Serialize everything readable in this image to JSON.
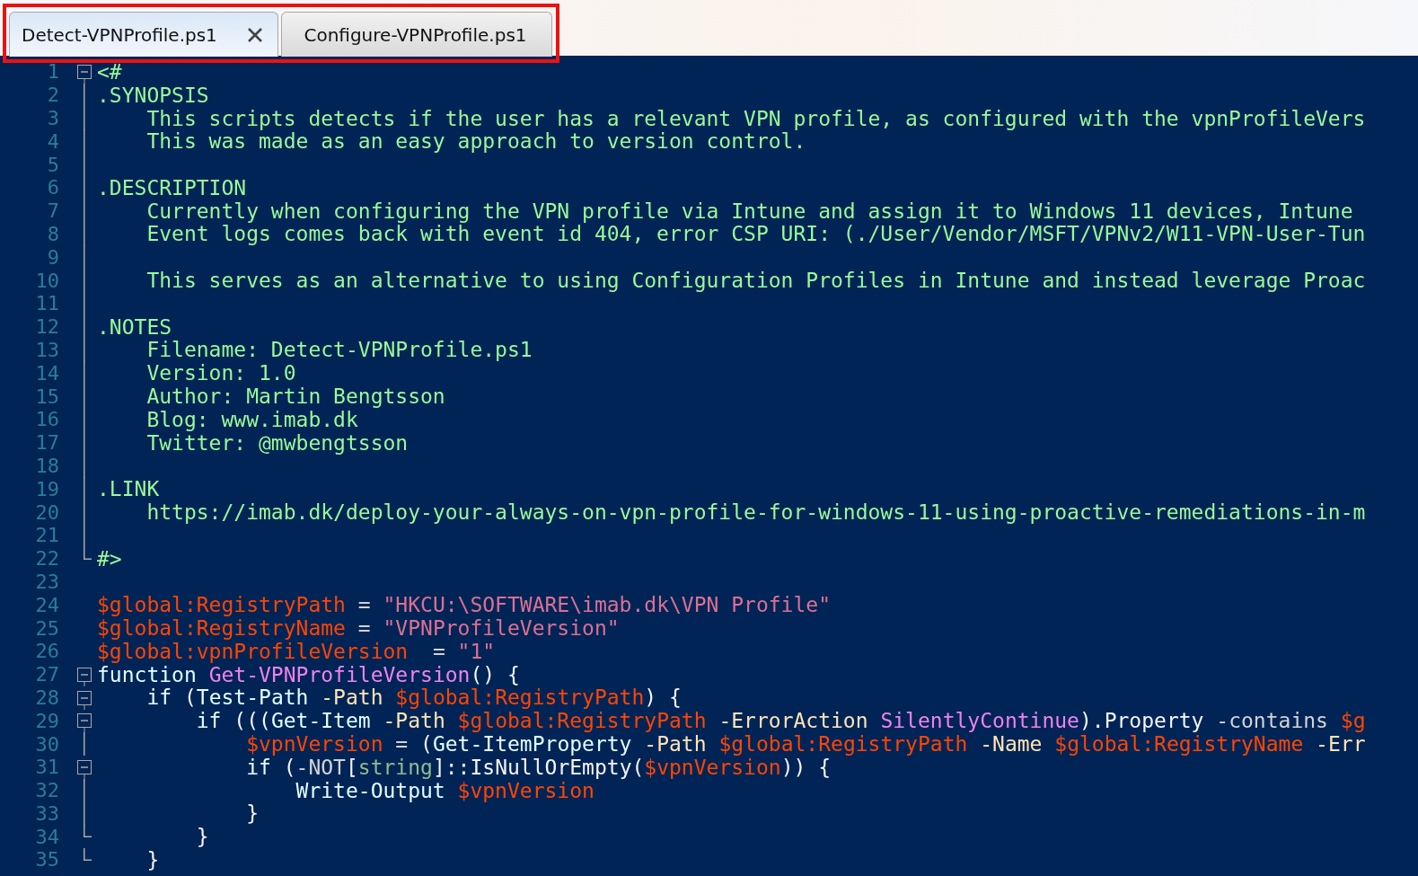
{
  "tabs": [
    {
      "label": "Detect-VPNProfile.ps1",
      "selected": true
    },
    {
      "label": "Configure-VPNProfile.ps1",
      "selected": false
    }
  ],
  "editor": {
    "lines": [
      {
        "number": "1",
        "kind": "open",
        "tokens": [
          {
            "text": "<#",
            "kind": "comment"
          }
        ]
      },
      {
        "number": "2",
        "kind": "line",
        "tokens": [
          {
            "text": ".SYNOPSIS",
            "kind": "comment"
          }
        ]
      },
      {
        "number": "3",
        "kind": "line",
        "tokens": [
          {
            "text": "    This scripts detects if the user has a relevant VPN profile, as configured with the vpnProfileVers",
            "kind": "comment"
          }
        ]
      },
      {
        "number": "4",
        "kind": "line",
        "tokens": [
          {
            "text": "    This was made as an easy approach to version control.",
            "kind": "comment"
          }
        ]
      },
      {
        "number": "5",
        "kind": "line"
      },
      {
        "number": "6",
        "kind": "line",
        "tokens": [
          {
            "text": ".DESCRIPTION",
            "kind": "comment"
          }
        ]
      },
      {
        "number": "7",
        "kind": "line",
        "tokens": [
          {
            "text": "    Currently when configuring the VPN profile via Intune and assign it to Windows 11 devices, Intune",
            "kind": "comment"
          }
        ]
      },
      {
        "number": "8",
        "kind": "line",
        "tokens": [
          {
            "text": "    Event logs comes back with event id 404, error CSP URI: (./User/Vendor/MSFT/VPNv2/W11-VPN-User-Tun",
            "kind": "comment"
          }
        ]
      },
      {
        "number": "9",
        "kind": "line"
      },
      {
        "number": "10",
        "kind": "line",
        "tokens": [
          {
            "text": "    This serves as an alternative to using Configuration Profiles in Intune and instead leverage Proac",
            "kind": "comment"
          }
        ]
      },
      {
        "number": "11",
        "kind": "line"
      },
      {
        "number": "12",
        "kind": "line",
        "tokens": [
          {
            "text": ".NOTES",
            "kind": "comment"
          }
        ]
      },
      {
        "number": "13",
        "kind": "line",
        "tokens": [
          {
            "text": "    Filename: Detect-VPNProfile.ps1",
            "kind": "comment"
          }
        ]
      },
      {
        "number": "14",
        "kind": "line",
        "tokens": [
          {
            "text": "    Version: 1.0",
            "kind": "comment"
          }
        ]
      },
      {
        "number": "15",
        "kind": "line",
        "tokens": [
          {
            "text": "    Author: Martin Bengtsson",
            "kind": "comment"
          }
        ]
      },
      {
        "number": "16",
        "kind": "line",
        "tokens": [
          {
            "text": "    Blog: www.imab.dk",
            "kind": "comment"
          }
        ]
      },
      {
        "number": "17",
        "kind": "line",
        "tokens": [
          {
            "text": "    Twitter: @mwbengtsson",
            "kind": "comment"
          }
        ]
      },
      {
        "number": "18",
        "kind": "line"
      },
      {
        "number": "19",
        "kind": "line",
        "tokens": [
          {
            "text": ".LINK",
            "kind": "comment"
          }
        ]
      },
      {
        "number": "20",
        "kind": "line",
        "tokens": [
          {
            "text": "    https://imab.dk/deploy-your-always-on-vpn-profile-for-windows-11-using-proactive-remediations-in-m",
            "kind": "comment"
          }
        ]
      },
      {
        "number": "21",
        "kind": "line"
      },
      {
        "number": "22",
        "kind": "end",
        "tokens": [
          {
            "text": "#>",
            "kind": "comment"
          }
        ]
      },
      {
        "number": "23"
      },
      {
        "number": "24",
        "tokens": [
          {
            "text": "$global:RegistryPath",
            "kind": "variable"
          },
          {
            "text": " = ",
            "kind": "operator"
          },
          {
            "text": "\"HKCU:\\SOFTWARE\\imab.dk\\VPN Profile\"",
            "kind": "string"
          }
        ]
      },
      {
        "number": "25",
        "tokens": [
          {
            "text": "$global:RegistryName",
            "kind": "variable"
          },
          {
            "text": " = ",
            "kind": "operator"
          },
          {
            "text": "\"VPNProfileVersion\"",
            "kind": "string"
          }
        ]
      },
      {
        "number": "26",
        "tokens": [
          {
            "text": "$global:vpnProfileVersion",
            "kind": "variable"
          },
          {
            "text": "  = ",
            "kind": "operator"
          },
          {
            "text": "\"1\"",
            "kind": "string"
          }
        ]
      },
      {
        "number": "27",
        "kind": "open",
        "tokens": [
          {
            "text": "function",
            "kind": "keyword"
          },
          {
            "text": " Get-VPNProfileVersion",
            "kind": "argument"
          },
          {
            "text": "() {",
            "kind": "plain"
          }
        ]
      },
      {
        "number": "28",
        "kind": "open",
        "tokens": [
          {
            "text": "    if",
            "kind": "keyword"
          },
          {
            "text": " (",
            "kind": "plain"
          },
          {
            "text": "Test-Path",
            "kind": "command"
          },
          {
            "text": " -Path",
            "kind": "parameter"
          },
          {
            "text": " $global:RegistryPath",
            "kind": "variable"
          },
          {
            "text": ") {",
            "kind": "plain"
          }
        ]
      },
      {
        "number": "29",
        "kind": "open",
        "tokens": [
          {
            "text": "        if",
            "kind": "keyword"
          },
          {
            "text": " (((",
            "kind": "plain"
          },
          {
            "text": "Get-Item",
            "kind": "command"
          },
          {
            "text": " -Path",
            "kind": "parameter"
          },
          {
            "text": " $global:RegistryPath",
            "kind": "variable"
          },
          {
            "text": " -ErrorAction",
            "kind": "parameter"
          },
          {
            "text": " SilentlyContinue",
            "kind": "argument"
          },
          {
            "text": ").Property",
            "kind": "plain"
          },
          {
            "text": " -contains",
            "kind": "operator"
          },
          {
            "text": " $g",
            "kind": "variable"
          }
        ]
      },
      {
        "number": "30",
        "kind": "line",
        "tokens": [
          {
            "text": "            $vpnVersion",
            "kind": "variable"
          },
          {
            "text": " = ",
            "kind": "operator"
          },
          {
            "text": "(",
            "kind": "plain"
          },
          {
            "text": "Get-ItemProperty",
            "kind": "command"
          },
          {
            "text": " -Path",
            "kind": "parameter"
          },
          {
            "text": " $global:RegistryPath",
            "kind": "variable"
          },
          {
            "text": " -Name",
            "kind": "parameter"
          },
          {
            "text": " $global:RegistryName",
            "kind": "variable"
          },
          {
            "text": " -Err",
            "kind": "parameter"
          }
        ]
      },
      {
        "number": "31",
        "kind": "open",
        "tokens": [
          {
            "text": "            if",
            "kind": "keyword"
          },
          {
            "text": " (",
            "kind": "plain"
          },
          {
            "text": "-NOT",
            "kind": "operator"
          },
          {
            "text": "[",
            "kind": "plain"
          },
          {
            "text": "string",
            "kind": "type"
          },
          {
            "text": "]::IsNullOrEmpty(",
            "kind": "plain"
          },
          {
            "text": "$vpnVersion",
            "kind": "variable"
          },
          {
            "text": ")) {",
            "kind": "plain"
          }
        ]
      },
      {
        "number": "32",
        "kind": "line",
        "tokens": [
          {
            "text": "                Write-Output",
            "kind": "command"
          },
          {
            "text": " $vpnVersion",
            "kind": "variable"
          }
        ]
      },
      {
        "number": "33",
        "kind": "line",
        "tokens": [
          {
            "text": "            }",
            "kind": "plain"
          }
        ]
      },
      {
        "number": "34",
        "kind": "end",
        "tokens": [
          {
            "text": "        }",
            "kind": "plain"
          }
        ]
      },
      {
        "number": "35",
        "kind": "end",
        "tokens": [
          {
            "text": "    }",
            "kind": "plain"
          }
        ]
      }
    ]
  }
}
